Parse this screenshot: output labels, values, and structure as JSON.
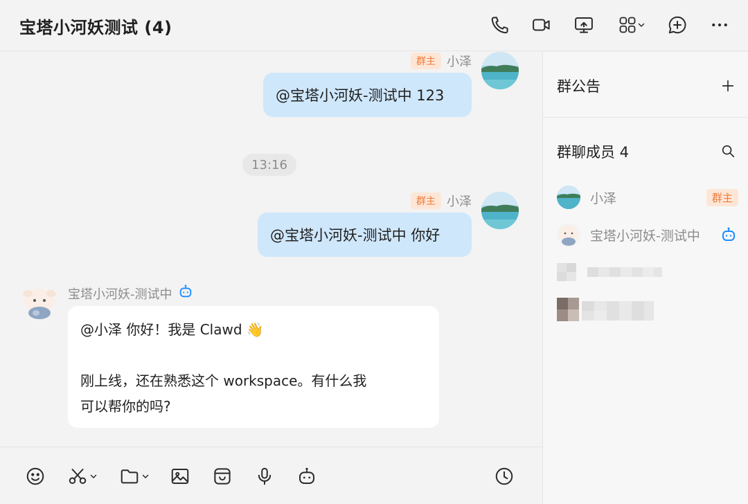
{
  "header": {
    "title": "宝塔小河妖测试 (4)",
    "icons": [
      "phone-icon",
      "video-icon",
      "screen-share-icon",
      "apps-icon",
      "add-chat-icon",
      "more-icon"
    ]
  },
  "messages": {
    "m1": {
      "badge": "群主",
      "sender": "小泽",
      "text": "@宝塔小河妖-测试中 123"
    },
    "time": "13:16",
    "m2": {
      "badge": "群主",
      "sender": "小泽",
      "text": "@宝塔小河妖-测试中 你好"
    },
    "m3": {
      "sender": "宝塔小河妖-测试中",
      "line1": "@小泽 你好！我是 Clawd 👋",
      "line2": "刚上线，还在熟悉这个 workspace。有什么我",
      "line3": "可以帮你的吗?"
    }
  },
  "toolbar": {
    "icons": [
      "emoji-icon",
      "scissors-icon",
      "folder-icon",
      "image-icon",
      "sticker-icon",
      "microphone-icon",
      "bot-icon",
      "clock-icon"
    ]
  },
  "panel": {
    "announcement_title": "群公告",
    "members_title": "群聊成员 4",
    "members": [
      {
        "name": "小泽",
        "badge": "群主"
      },
      {
        "name": "宝塔小河妖-测试中"
      }
    ]
  },
  "colors": {
    "bubble_me": "#cfe7fb",
    "owner_badge_bg": "#fde6d6",
    "owner_badge_text": "#f07a3a",
    "bot_blue": "#1a8cff"
  }
}
